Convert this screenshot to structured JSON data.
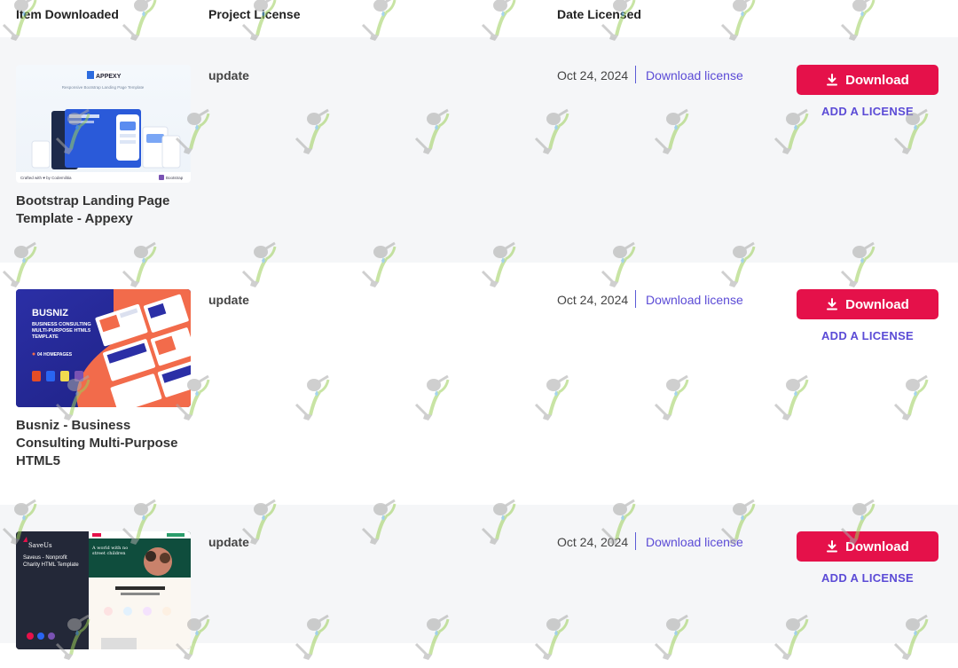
{
  "table_header": {
    "item": "Item Downloaded",
    "license": "Project License",
    "date": "Date Licensed"
  },
  "rows": [
    {
      "title": "Bootstrap Landing Page Template - Appexy",
      "license_type": "update",
      "date": "Oct 24, 2024",
      "download_license": "Download license",
      "download_label": "Download",
      "add_license": "ADD A LICENSE",
      "thumb": {
        "brand": "APPEXY",
        "tagline": "Responsive Bootstrap Landing Page Template",
        "footer": "Crafted with ♥ by Codemilitia",
        "badge": "Bootstrap"
      }
    },
    {
      "title": "Busniz - Business Consulting Multi-Purpose HTML5",
      "license_type": "update",
      "date": "Oct 24, 2024",
      "download_license": "Download license",
      "download_label": "Download",
      "add_license": "ADD A LICENSE",
      "thumb": {
        "brand": "BUSNIZ",
        "tagline": "BUSINESS CONSULTING MULTI-PURPOSE HTML5 TEMPLATE",
        "footer": "04 HOMEPAGES"
      }
    },
    {
      "title": "Saveus - Nonprofit Charity HTML Template",
      "license_type": "update",
      "date": "Oct 24, 2024",
      "download_license": "Download license",
      "download_label": "Download",
      "add_license": "ADD A LICENSE",
      "thumb": {
        "brand": "SaveUs",
        "tagline": "Saveus - Nonprofit Charity HTML Template",
        "footer": "A world with no street children"
      }
    }
  ],
  "colors": {
    "accent": "#e5114a",
    "link": "#5b4bd6",
    "row_shade": "#f5f6f8"
  }
}
